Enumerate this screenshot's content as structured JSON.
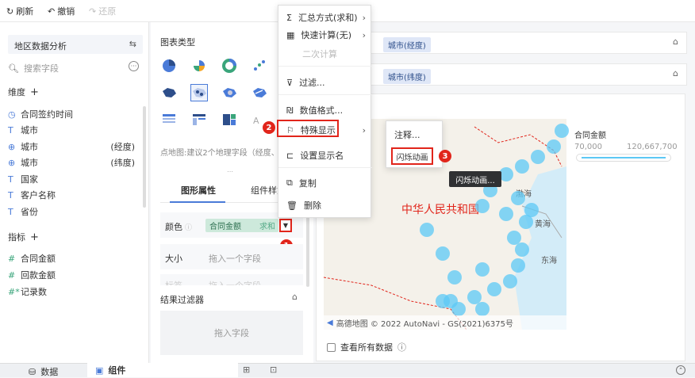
{
  "toolbar": {
    "refresh": "刷新",
    "undo": "撤销",
    "redo": "还原"
  },
  "left": {
    "dataset": "地区数据分析",
    "search_placeholder": "搜索字段",
    "dim_title": "维度",
    "dims": [
      {
        "label": "合同签约时间",
        "icon": "clock-icon",
        "extra": ""
      },
      {
        "label": "城市",
        "icon": "text-icon",
        "extra": ""
      },
      {
        "label": "城市",
        "icon": "globe-icon",
        "extra": "(经度)"
      },
      {
        "label": "城市",
        "icon": "globe-icon",
        "extra": "(纬度)"
      },
      {
        "label": "国家",
        "icon": "text-icon",
        "extra": ""
      },
      {
        "label": "客户名称",
        "icon": "text-icon",
        "extra": ""
      },
      {
        "label": "省份",
        "icon": "text-icon",
        "extra": ""
      }
    ],
    "measure_title": "指标",
    "measures": [
      {
        "label": "合同金额",
        "icon": "hash-icon"
      },
      {
        "label": "回款金额",
        "icon": "hash-icon"
      },
      {
        "label": "记录数",
        "icon": "hash-star-icon"
      }
    ]
  },
  "middle": {
    "chart_type_title": "图表类型",
    "hint": "点地图:建议2个地理字段（经度、",
    "tab_graph": "图形属性",
    "tab_component": "组件样式",
    "color_label": "颜色",
    "color_pill": "合同金额",
    "color_agg": "求和",
    "size_label": "大小",
    "size_placeholder": "拖入一个字段",
    "label_label": "标签",
    "label_placeholder": "拖入一个字段",
    "filter_title": "结果过滤器",
    "filter_placeholder": "拖入字段"
  },
  "right": {
    "x_pill": "城市(经度)",
    "y_pill": "城市(纬度)",
    "map_label": "中华人民共和国",
    "bohai": "渤海",
    "huanghai": "黄海",
    "donghai": "东海",
    "legend_title": "合同金额",
    "legend_min": "70,000",
    "legend_max": "120,667,700",
    "attribution": "高德地图 © 2022 AutoNavi - GS(2021)6375号",
    "view_all": "查看所有数据"
  },
  "menu": {
    "items": [
      {
        "label": "汇总方式(求和)"
      },
      {
        "label": "快速计算(无)"
      },
      {
        "label": "二次计算"
      },
      {
        "label": "过滤..."
      },
      {
        "label": "数值格式..."
      },
      {
        "label": "特殊显示"
      },
      {
        "label": "设置显示名"
      },
      {
        "label": "复制"
      },
      {
        "label": "删除"
      }
    ],
    "sub_items": [
      {
        "label": "注释..."
      },
      {
        "label": "闪烁动画"
      }
    ],
    "tooltip": "闪烁动画..."
  },
  "badges": [
    "1",
    "2",
    "3"
  ],
  "bottom": {
    "data_tab": "数据",
    "component_tab": "组件"
  },
  "colors": {
    "accent": "#4a7bd8",
    "red": "#e1251b",
    "bubble": "#5cc8f5"
  }
}
